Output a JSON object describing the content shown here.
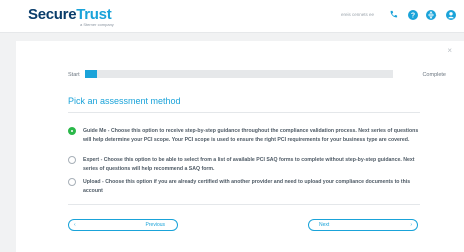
{
  "header": {
    "logo_main": "Secure",
    "logo_accent": "Trust",
    "logo_sub": "a Sterner company",
    "user_text": "ereis cennets ee"
  },
  "progress": {
    "start_label": "Start",
    "end_label": "Complete",
    "value": 0.04
  },
  "form": {
    "heading": "Pick an assessment method",
    "options": [
      {
        "text": "Guide Me - Choose this option to receive step-by-step guidance throughout the compliance validation process. Next series of questions will help determine your PCI scope. Your PCI scope is used to ensure the right PCI requirements for your business type are covered.",
        "selected": true
      },
      {
        "text": "Expert - Choose this option to be able to select from a list of available PCI SAQ forms to complete without step-by-step guidance. Next series of questions will help recommend a SAQ form.",
        "selected": false
      },
      {
        "text": "Upload - Choose this option if you are already certified with another provider and need to upload your compliance documents to this account",
        "selected": false
      }
    ]
  },
  "nav": {
    "previous_label": "Previous",
    "next_label": "Next",
    "prev_chevron": "‹",
    "next_chevron": "›"
  },
  "close_glyph": "×",
  "colors": {
    "accent": "#1aa3d9",
    "brand_dark": "#0a3d6b",
    "selected": "#2bb84a"
  }
}
